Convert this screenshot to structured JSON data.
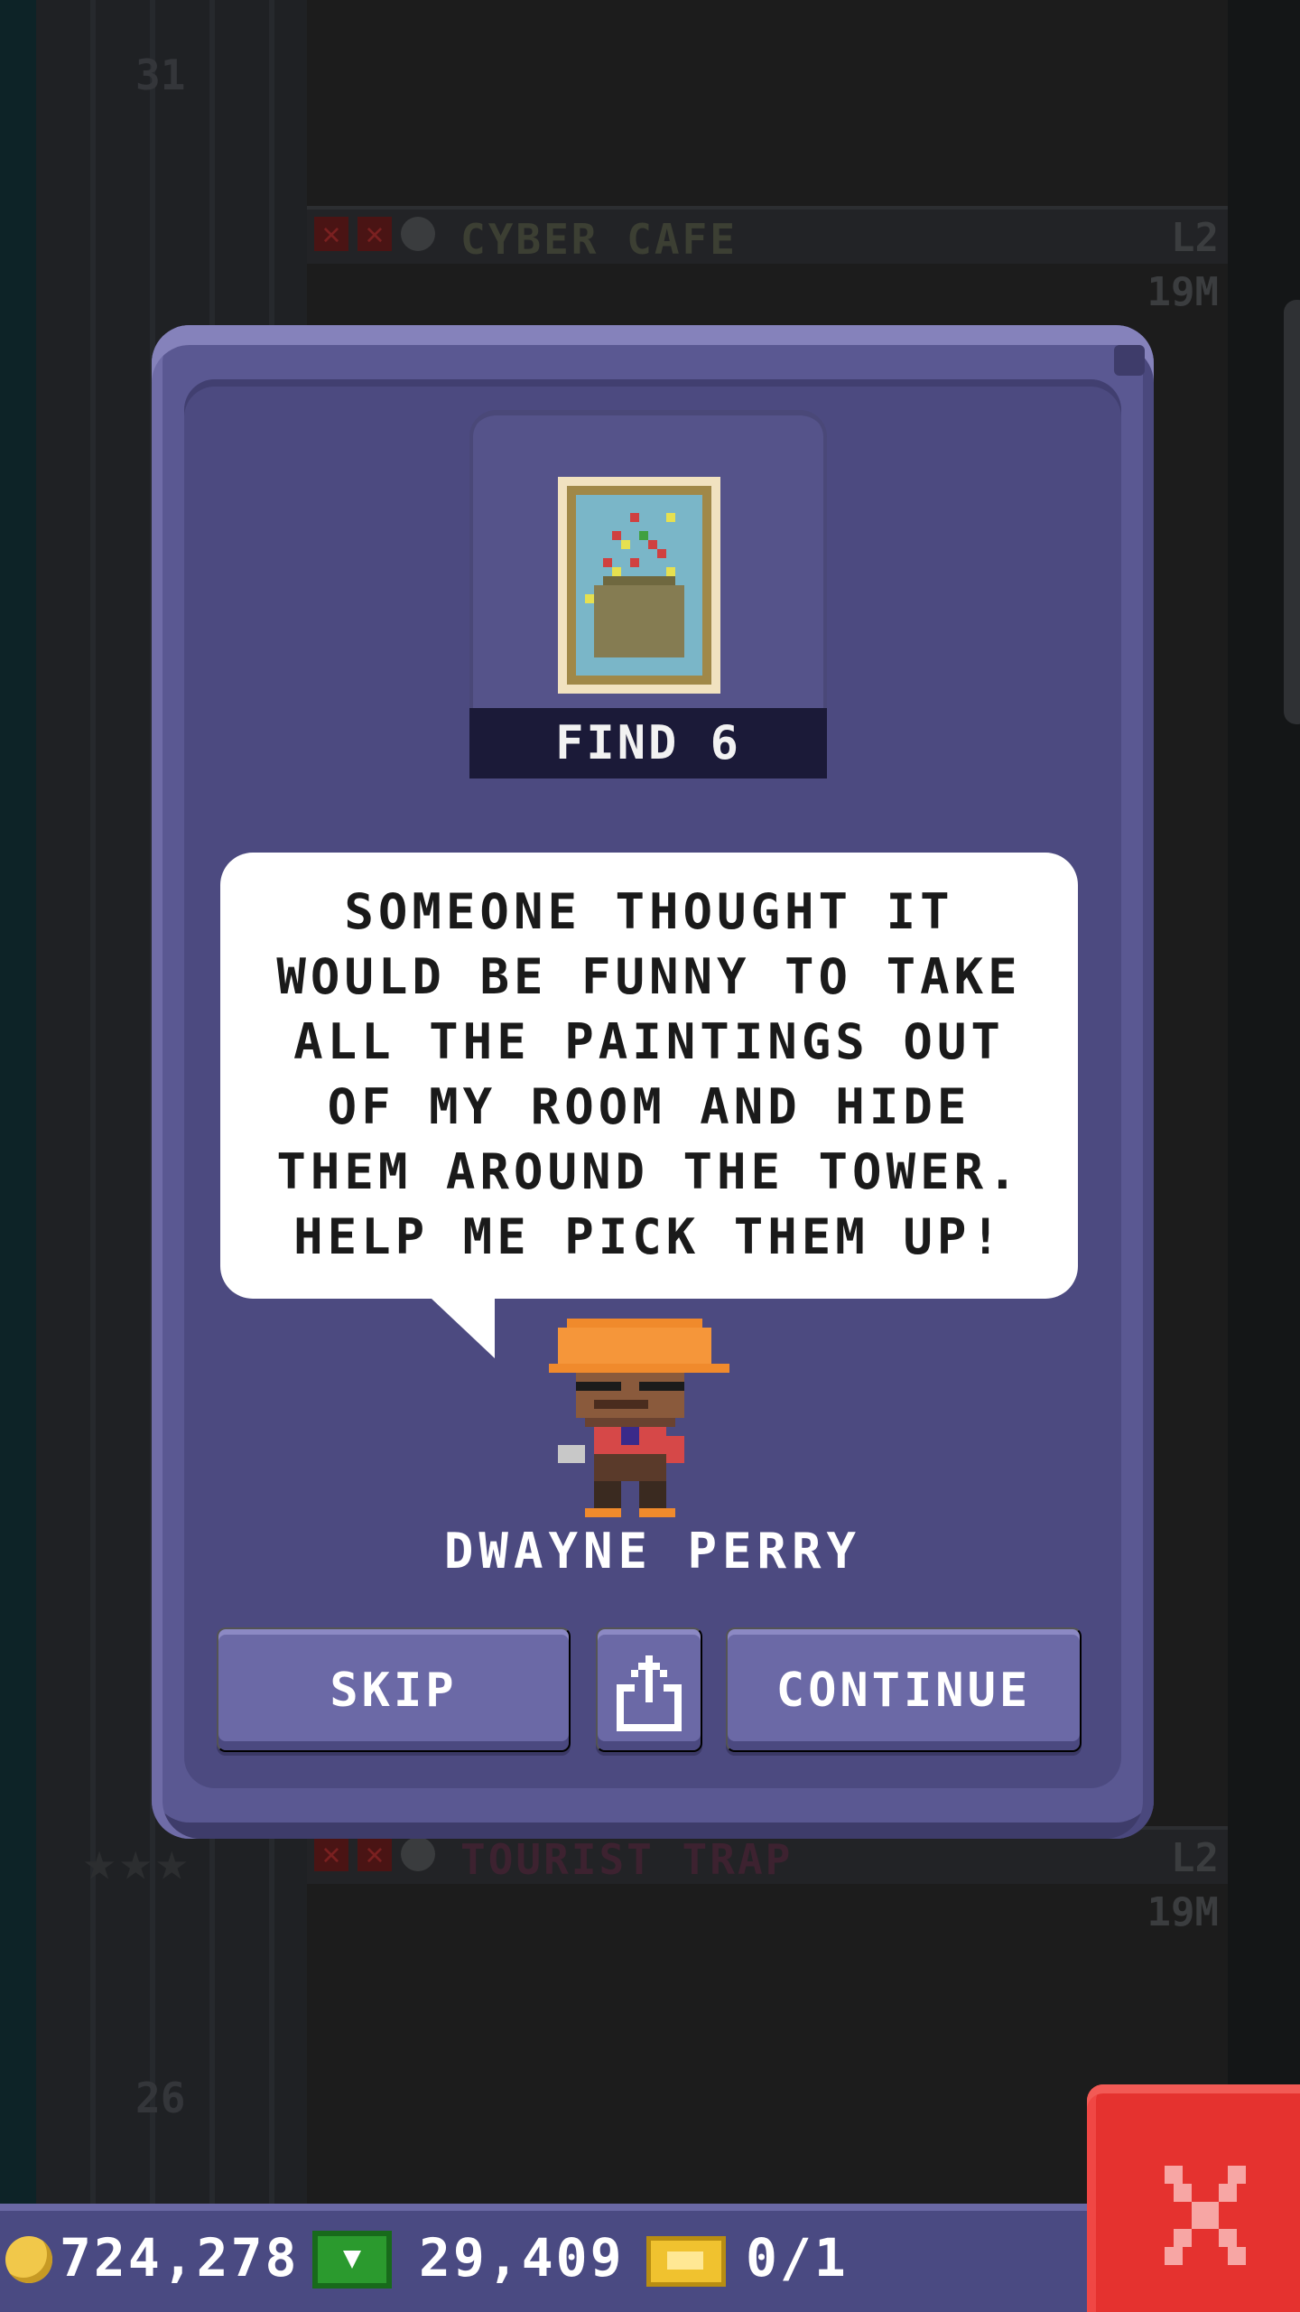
{
  "background": {
    "floors": [
      {
        "name": "CYBER CAFE",
        "level": "L2",
        "value": "19M"
      },
      {
        "name": "TOURIST TRAP",
        "level": "L2",
        "value": "19M"
      }
    ],
    "floor_numbers": [
      "31",
      "26"
    ]
  },
  "dialog": {
    "objective": "FIND 6",
    "message": "SOMEONE THOUGHT IT WOULD BE FUNNY TO TAKE ALL THE PAINTINGS OUT OF MY ROOM AND HIDE THEM AROUND THE TOWER. HELP ME PICK THEM UP!",
    "character_name": "DWAYNE PERRY",
    "buttons": {
      "skip": "SKIP",
      "share_icon": "share-icon",
      "continue": "CONTINUE"
    }
  },
  "status_bar": {
    "coins": "724,278",
    "bux": "29,409",
    "tickets": "0/1"
  },
  "colors": {
    "dialog": "#5a5892",
    "bubble": "#ffffff",
    "close": "#e5322f"
  }
}
